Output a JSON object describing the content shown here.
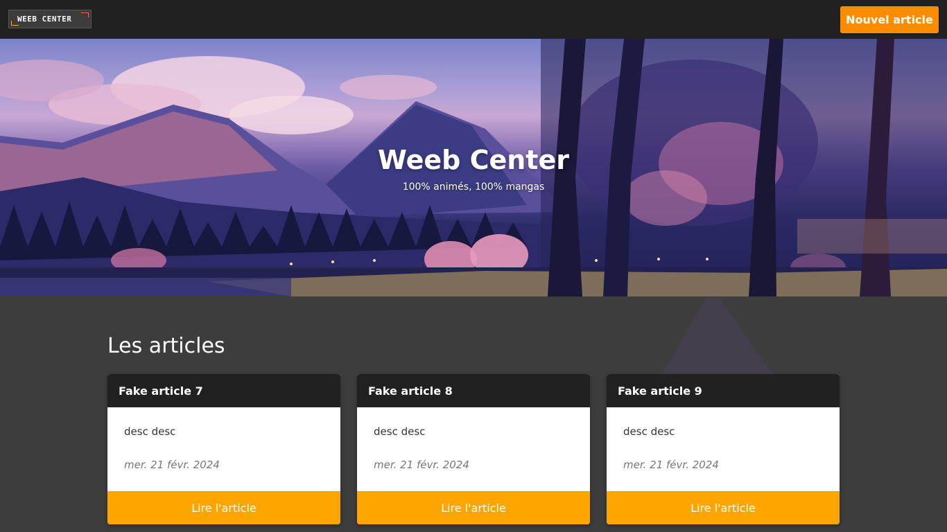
{
  "navbar": {
    "logo_text": "WEEB CENTER",
    "new_article_label": "Nouvel article"
  },
  "hero": {
    "title": "Weeb Center",
    "subtitle": "100% animés, 100% mangas"
  },
  "articles_section": {
    "title": "Les articles",
    "articles": [
      {
        "title": "Fake article 7",
        "description": "desc desc",
        "date": "mer. 21 févr. 2024",
        "button_label": "Lire l'article"
      },
      {
        "title": "Fake article 8",
        "description": "desc desc",
        "date": "mer. 21 févr. 2024",
        "button_label": "Lire l'article"
      },
      {
        "title": "Fake article 9",
        "description": "desc desc",
        "date": "mer. 21 févr. 2024",
        "button_label": "Lire l'article"
      }
    ]
  },
  "colors": {
    "accent_orange": "#ff8c00",
    "card_button": "#ffa500",
    "navbar": "#212121",
    "page_background": "#3d3d3d"
  }
}
